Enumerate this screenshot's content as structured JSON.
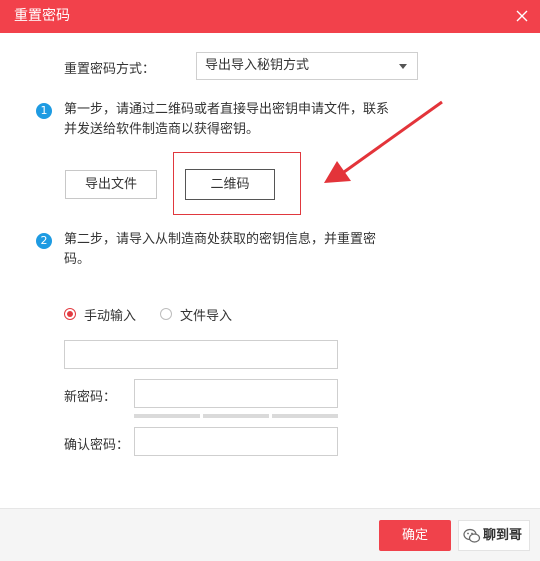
{
  "dialog": {
    "title": "重置密码"
  },
  "form": {
    "method_label": "重置密码方式：",
    "method_value": "导出导入秘钥方式"
  },
  "step1": {
    "number": "1",
    "line1": "第一步，请通过二维码或者直接导出密钥申请文件，联系",
    "line2": "并发送给软件制造商以获得密钥。",
    "export_button": "导出文件",
    "qrcode_button": "二维码"
  },
  "step2": {
    "number": "2",
    "line1": "第二步，请导入从制造商处获取的密钥信息，并重置密",
    "line2": "码。",
    "radio_manual": "手动输入",
    "radio_file": "文件导入",
    "manual_input_value": "",
    "new_password_label": "新密码：",
    "new_password_value": "",
    "confirm_password_label": "确认密码：",
    "confirm_password_value": ""
  },
  "footer": {
    "confirm_button": "确定",
    "watermark": "聊到哥"
  },
  "colors": {
    "titlebar": "#f2414b",
    "accent": "#f0424b",
    "step_badge": "#1e9be2",
    "highlight": "#e0383e"
  },
  "icons": {
    "close": "close-icon",
    "caret": "chevron-down-icon",
    "annotation": "arrow-icon",
    "watermark": "wechat-icon"
  }
}
